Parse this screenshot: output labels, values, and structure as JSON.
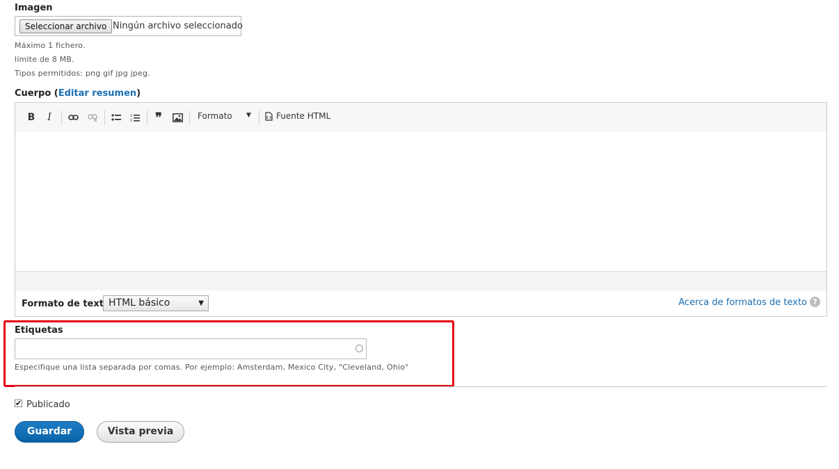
{
  "image_field": {
    "label": "Imagen",
    "button_label": "Seleccionar archivo",
    "file_status": "Ningún archivo seleccionado",
    "help_lines": [
      "Máximo 1 fichero.",
      "límite de 8 MB.",
      "Tipos permitidos: png gif jpg jpeg."
    ]
  },
  "body_field": {
    "label": "Cuerpo (",
    "link": "Editar resumen",
    "label_end": ")",
    "toolbar": {
      "bold": "B",
      "italic": "I",
      "format_label": "Formato",
      "source_label": "Fuente HTML",
      "icons": [
        "bold-icon",
        "italic-icon",
        "link-icon",
        "unlink-icon",
        "bulleted-list-icon",
        "numbered-list-icon",
        "blockquote-icon",
        "image-icon",
        "source-icon"
      ]
    },
    "text_format": {
      "label": "Formato de texto",
      "selected": "HTML básico",
      "about_link": "Acerca de formatos de texto",
      "help_glyph": "?"
    }
  },
  "tags_field": {
    "label": "Etiquetas",
    "value": "",
    "description": "Especifique una lista separada por comas. Por ejemplo: Amsterdam, Mexico City, \"Cleveland, Ohio\""
  },
  "published": {
    "label": "Publicado",
    "checked": true
  },
  "actions": {
    "save": "Guardar",
    "preview": "Vista previa"
  },
  "colors": {
    "primary": "#0a63a8",
    "link": "#1a6fb3",
    "highlight": "#e6000f"
  }
}
